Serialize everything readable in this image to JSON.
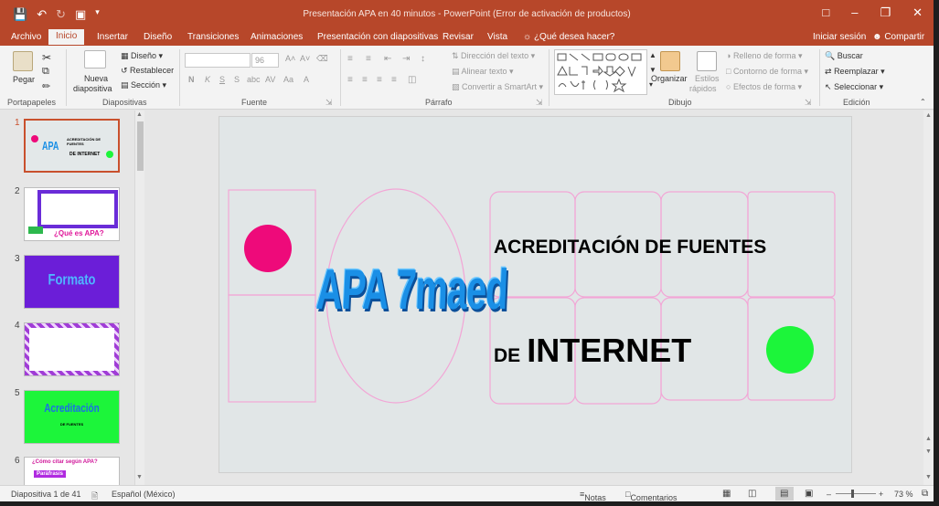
{
  "window": {
    "title": "Presentación APA en 40 minutos - PowerPoint (Error de activación de productos)"
  },
  "tabs": [
    "Archivo",
    "Inicio",
    "Insertar",
    "Diseño",
    "Transiciones",
    "Animaciones",
    "Presentación con diapositivas",
    "Revisar",
    "Vista"
  ],
  "tell_me": "¿Qué desea hacer?",
  "account": {
    "signin": "Iniciar sesión",
    "share": "Compartir"
  },
  "ribbon": {
    "clipboard": {
      "label": "Portapapeles",
      "paste": "Pegar"
    },
    "slides": {
      "label": "Diapositivas",
      "new_slide_line1": "Nueva",
      "new_slide_line2": "diapositiva",
      "layout": "Diseño",
      "reset": "Restablecer",
      "section": "Sección"
    },
    "font": {
      "label": "Fuente",
      "size": "96",
      "bold": "N",
      "italic": "K",
      "underline": "S",
      "strike": "S",
      "shadow": "abc",
      "spacing": "AV",
      "case": "Aa"
    },
    "paragraph": {
      "label": "Párrafo",
      "direction": "Dirección del texto",
      "align": "Alinear texto",
      "smartart": "Convertir a SmartArt"
    },
    "drawing": {
      "label": "Dibujo",
      "arrange": "Organizar",
      "styles_line1": "Estilos",
      "styles_line2": "rápidos",
      "fill": "Relleno de forma",
      "outline": "Contorno de forma",
      "effects": "Efectos de forma"
    },
    "editing": {
      "label": "Edición",
      "find": "Buscar",
      "replace": "Reemplazar",
      "select": "Seleccionar"
    }
  },
  "thumbnails": [
    {
      "num": "1",
      "title": "ACREDITACIÓN DE FUENTES",
      "sub": "DE INTERNET",
      "art": "APA"
    },
    {
      "num": "2",
      "caption": "¿Qué es APA?"
    },
    {
      "num": "3",
      "title": "Formato"
    },
    {
      "num": "4"
    },
    {
      "num": "5",
      "title": "Acreditación",
      "sub": "DE FUENTES"
    },
    {
      "num": "6",
      "title": "¿Cómo citar según APA?",
      "chip": "Paráfrasis"
    }
  ],
  "slide": {
    "title_line1": "ACREDITACIÓN DE FUENTES",
    "title_line2_small": "DE",
    "title_line2_big": "INTERNET",
    "wordart": "APA 7maed",
    "colors": {
      "magenta": "#ee0a7a",
      "green": "#1cf53a",
      "wordart": "#1a8fe6",
      "grid": "#f2a6d6"
    }
  },
  "status": {
    "slide_count": "Diapositiva 1 de 41",
    "language": "Español (México)",
    "notes": "Notas",
    "comments": "Comentarios",
    "zoom": "73 %"
  },
  "theme": {
    "accent": "#b7472a"
  }
}
